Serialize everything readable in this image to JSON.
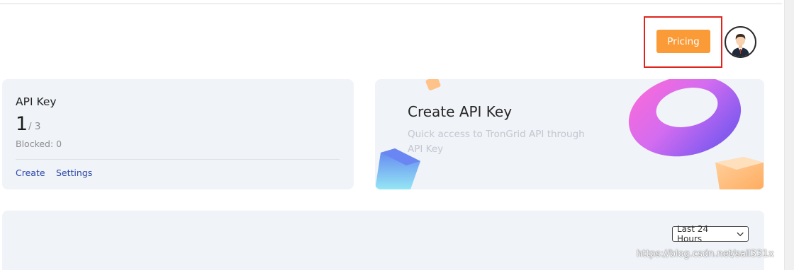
{
  "header": {
    "pricing_label": "Pricing"
  },
  "api_key_card": {
    "title": "API Key",
    "used": "1",
    "limit": "/ 3",
    "blocked": "Blocked: 0",
    "actions": [
      "Create",
      "Settings"
    ]
  },
  "create_card": {
    "title": "Create API Key",
    "description": "Quick access to TronGrid API through API Key"
  },
  "stats": {
    "range_label": "Last 24 Hours"
  },
  "watermark": "https://blog.csdn.net/sail331x",
  "colors": {
    "pricing_button": "#fb9b38",
    "highlight_box": "#e0241c",
    "card_bg": "#f0f3f8",
    "link": "#2a45a8"
  }
}
